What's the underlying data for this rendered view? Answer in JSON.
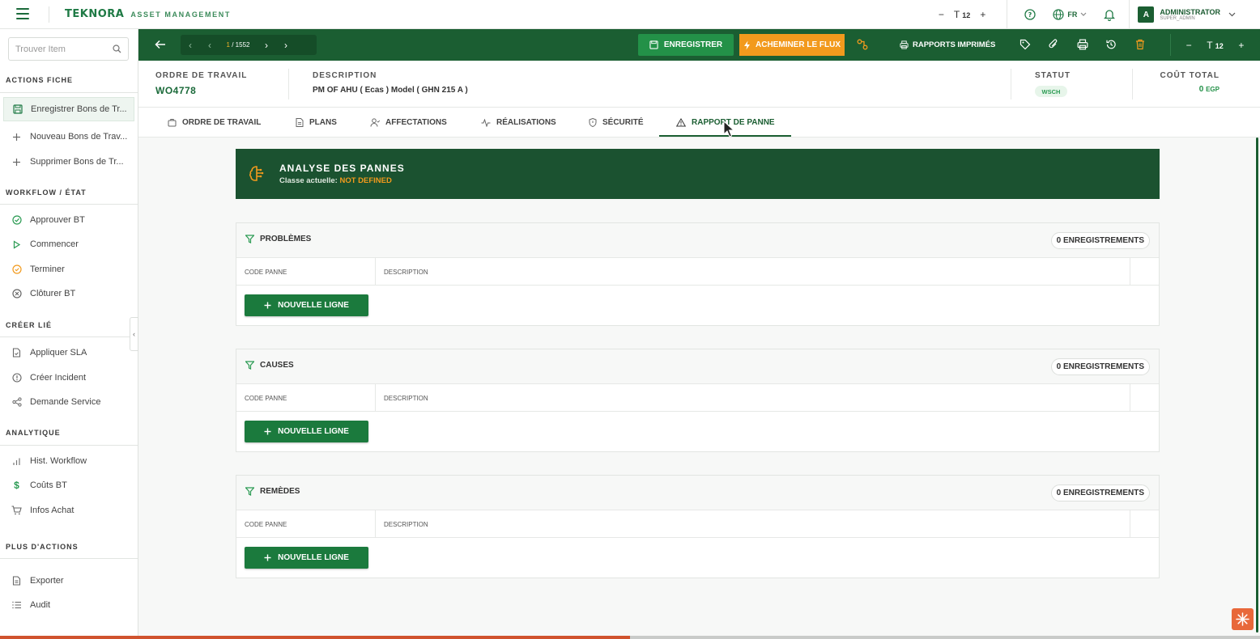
{
  "topbar": {
    "brand_logo": "TEKNORA",
    "brand_sub": "ASSET MANAGEMENT",
    "font_size_value": "12",
    "font_minus": "−",
    "font_plus": "+",
    "font_icon_label": "T",
    "lang": "FR",
    "avatar_letter": "A",
    "user_name": "ADMINISTRATOR",
    "user_role": "SUPER_ADMIN"
  },
  "sidebar": {
    "search_placeholder": "Trouver Item",
    "sections": {
      "actions_fiche": "ACTIONS FICHE",
      "workflow": "WORKFLOW / ÉTAT",
      "creer_lie": "CRÉER LIÉ",
      "analytique": "ANALYTIQUE",
      "plus_actions": "PLUS D'ACTIONS"
    },
    "items": {
      "enregistrer": "Enregistrer Bons de Tr...",
      "nouveau": "Nouveau Bons de Trav...",
      "supprimer": "Supprimer Bons de Tr...",
      "approuver": "Approuver BT",
      "commencer": "Commencer",
      "terminer": "Terminer",
      "cloturer": "Clôturer BT",
      "appliquer_sla": "Appliquer SLA",
      "creer_incident": "Créer Incident",
      "demande_service": "Demande Service",
      "hist_workflow": "Hist. Workflow",
      "couts_bt": "Coûts BT",
      "infos_achat": "Infos Achat",
      "exporter": "Exporter",
      "audit": "Audit"
    }
  },
  "toolbar": {
    "page_current": "1",
    "page_total": "/ 1552",
    "save_label": "ENREGISTRER",
    "flow_label": "ACHEMINER LE FLUX",
    "reports_label": "RAPPORTS IMPRIMÉS",
    "font_size_value": "12",
    "font_icon_label": "T",
    "font_minus": "−",
    "font_plus": "+"
  },
  "header": {
    "order_label": "ORDRE DE TRAVAIL",
    "order_value": "WO4778",
    "desc_label": "DESCRIPTION",
    "desc_value": "PM OF AHU   ( Ecas )  Model ( GHN 215 A )",
    "status_label": "STATUT",
    "status_value": "WSCH",
    "cost_label": "COÛT TOTAL",
    "cost_value": "0",
    "cost_currency": "EGP"
  },
  "tabs": [
    {
      "label": "ORDRE DE TRAVAIL"
    },
    {
      "label": "PLANS"
    },
    {
      "label": "AFFECTATIONS"
    },
    {
      "label": "RÉALISATIONS"
    },
    {
      "label": "SÉCURITÉ"
    },
    {
      "label": "RAPPORT DE PANNE"
    }
  ],
  "active_tab": "RAPPORT DE PANNE",
  "banner": {
    "title": "ANALYSE DES PANNES",
    "class_label": "Classe actuelle:",
    "class_value": "NOT DEFINED"
  },
  "panels": [
    {
      "title": "PROBLÈMES",
      "count": "0 ENREGISTREMENTS",
      "col1": "CODE PANNE",
      "col2": "DESCRIPTION",
      "button": "NOUVELLE LIGNE"
    },
    {
      "title": "CAUSES",
      "count": "0 ENREGISTREMENTS",
      "col1": "CODE PANNE",
      "col2": "DESCRIPTION",
      "button": "NOUVELLE LIGNE"
    },
    {
      "title": "REMÈDES",
      "count": "0 ENREGISTREMENTS",
      "col1": "CODE PANNE",
      "col2": "DESCRIPTION",
      "button": "NOUVELLE LIGNE"
    }
  ],
  "colors": {
    "primary_green": "#1b5e32",
    "save_green": "#239148",
    "flow_orange": "#f29a1d",
    "banner_green": "#1b5230"
  },
  "page_progress": 0.5
}
